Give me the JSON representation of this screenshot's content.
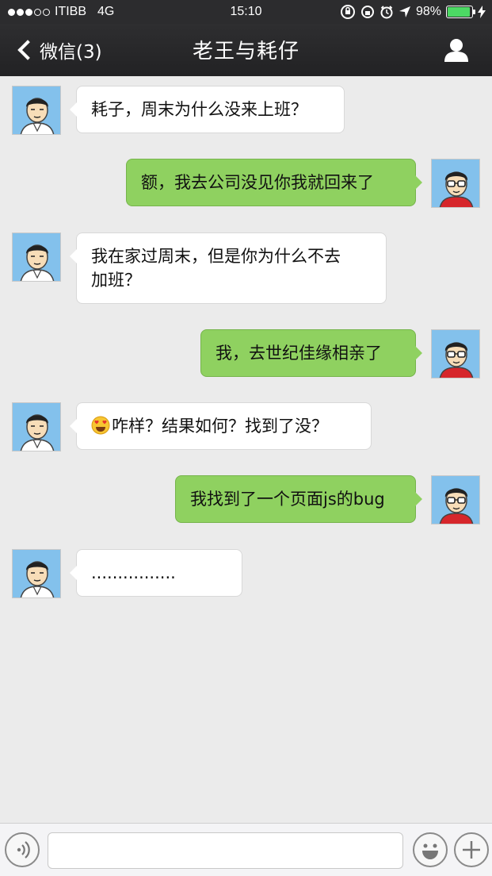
{
  "status_bar": {
    "carrier": "ITIBB",
    "network": "4G",
    "time": "15:10",
    "battery": "98%",
    "battery_level": 0.98,
    "signal_bars": 3,
    "signal_total": 5
  },
  "header": {
    "back_label": "微信(3)",
    "title": "老王与耗仔"
  },
  "messages": [
    {
      "side": "left",
      "text": "耗子，周末为什么没来上班？",
      "emoji": ""
    },
    {
      "side": "right",
      "text": "额，我去公司没见你我就回来了",
      "emoji": ""
    },
    {
      "side": "left",
      "text": "我在家过周末，但是你为什么不去\n加班？",
      "emoji": ""
    },
    {
      "side": "right",
      "text": "我，去世纪佳缘相亲了",
      "emoji": ""
    },
    {
      "side": "left",
      "text": "咋样？结果如何？找到了没？",
      "emoji": "heart-eyes-emoji"
    },
    {
      "side": "right",
      "text": "我找到了一个页面js的bug",
      "emoji": ""
    },
    {
      "side": "left",
      "text": "................",
      "emoji": ""
    }
  ],
  "input": {
    "value": "",
    "placeholder": ""
  },
  "icons": {
    "back": "chevron-left-icon",
    "profile": "person-icon",
    "voice": "voice-icon",
    "emoji": "smiley-icon",
    "more": "plus-icon"
  },
  "colors": {
    "bar_background": "#2c2c2e",
    "chat_background": "#ebebeb",
    "bubble_self": "#8fd160",
    "bubble_other": "#ffffff",
    "battery": "#4cd964",
    "avatar_background": "#83c1ec"
  }
}
